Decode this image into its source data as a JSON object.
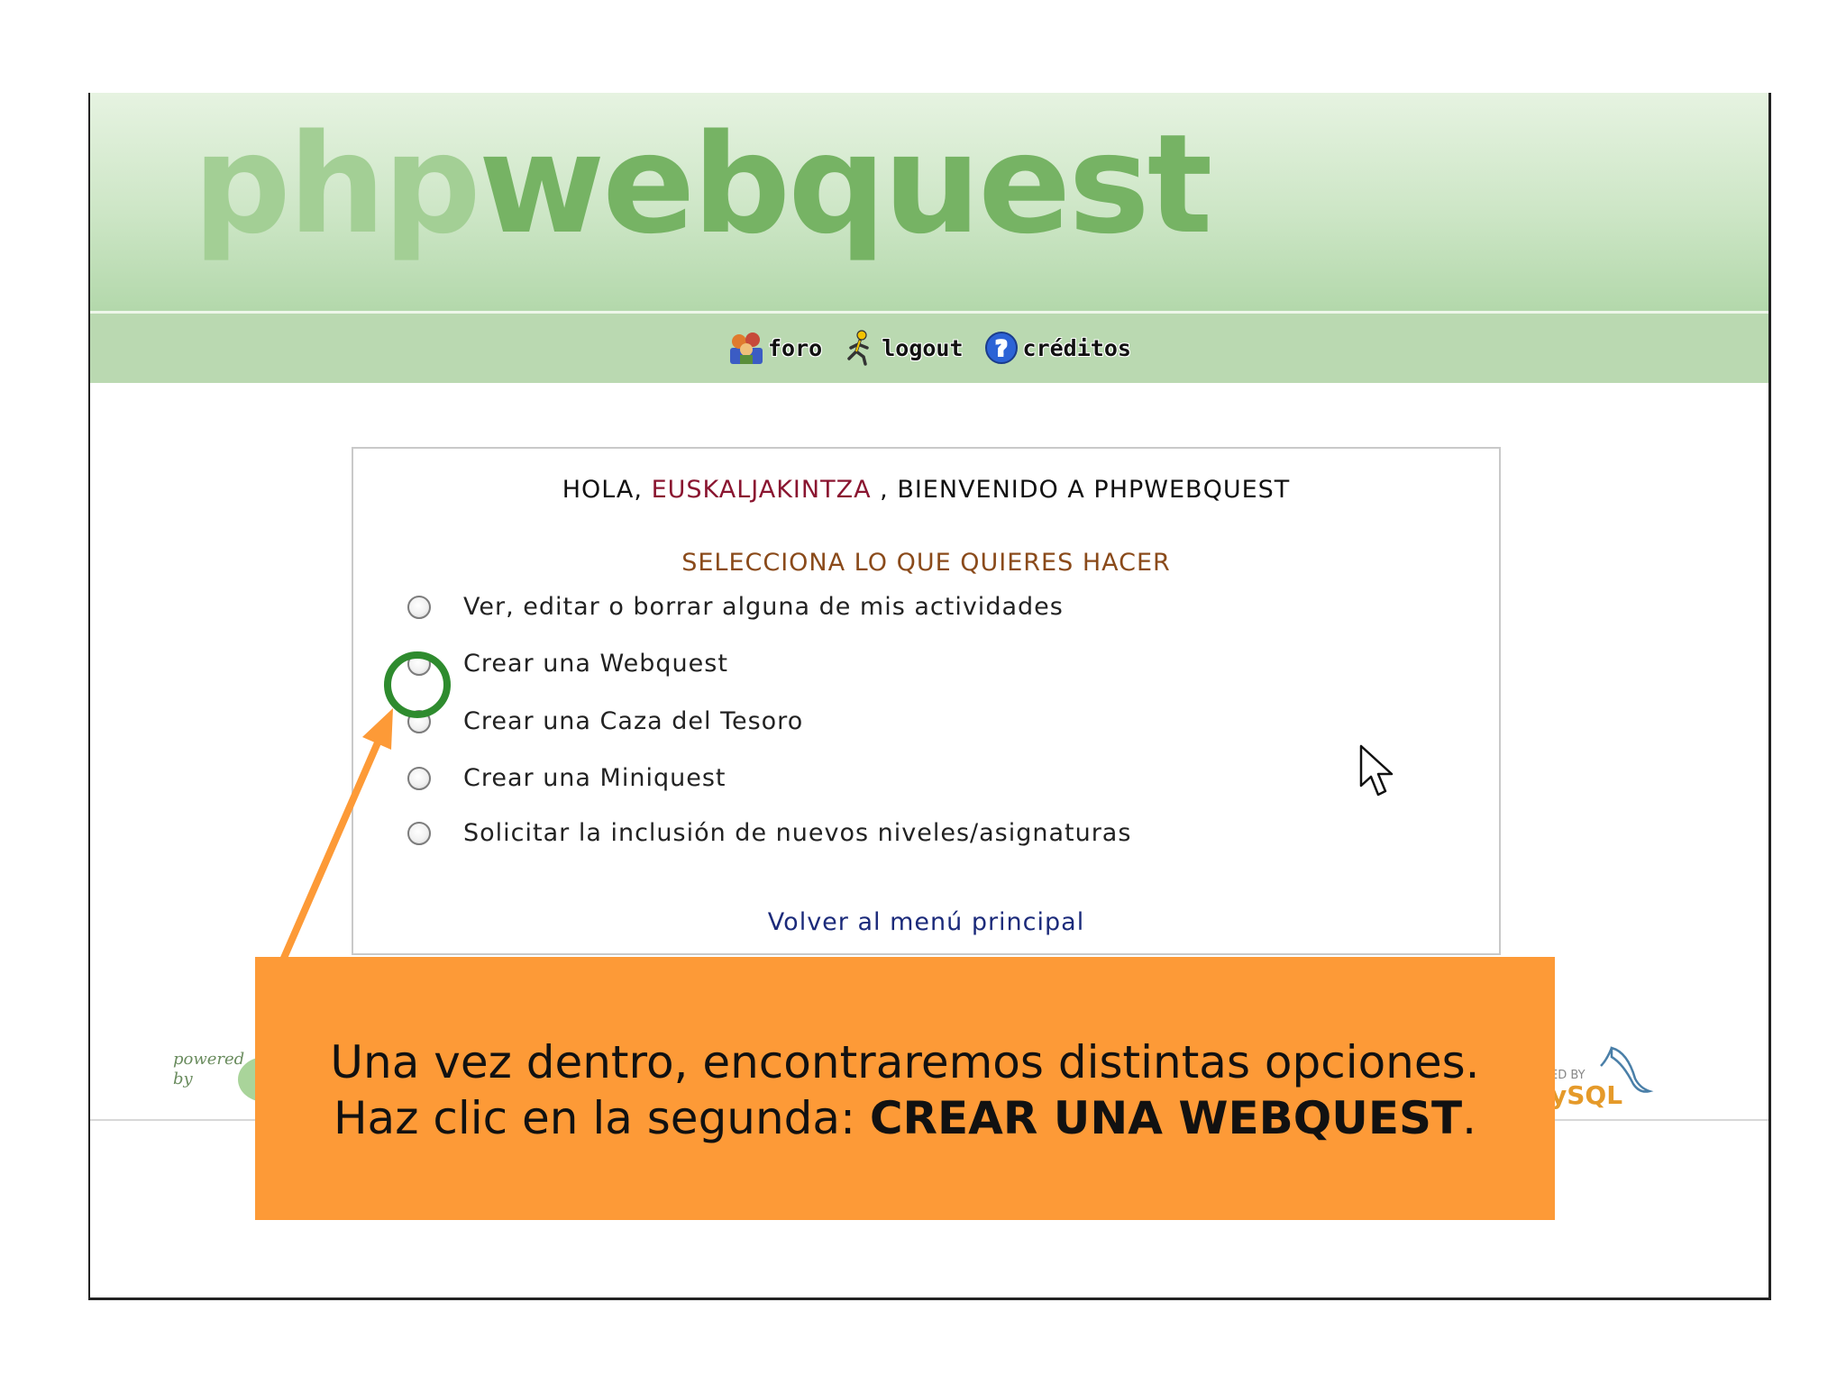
{
  "header": {
    "logo": {
      "part1": "php",
      "part2": "webquest"
    },
    "nav": [
      {
        "label": "foro",
        "icon": "forum-people-icon"
      },
      {
        "label": "logout",
        "icon": "running-man-icon"
      },
      {
        "label": "créditos",
        "icon": "help-icon"
      }
    ]
  },
  "panel": {
    "greeting_prefix": "HOLA,",
    "username": "EUSKALJAKINTZA",
    "greeting_suffix": ", BIENVENIDO A PHPWEBQUEST",
    "select_title": "SELECCIONA LO QUE QUIERES HACER",
    "options": [
      "Ver, editar o borrar alguna de mis actividades",
      "Crear una Webquest",
      "Crear una Caza del Tesoro",
      "Crear una Miniquest",
      "Solicitar la inclusión de nuevos niveles/asignaturas"
    ],
    "back_link": "Volver al menú principal"
  },
  "footer": {
    "powered_left": [
      "powered",
      "by"
    ],
    "powered_right_text": "ED BY",
    "powered_right_logo": "ySQL"
  },
  "callout": {
    "line1": "Una vez dentro, encontraremos distintas opciones.",
    "line2_prefix": "Haz clic en la segunda: ",
    "line2_bold": "CREAR UNA WEBQUEST",
    "line2_suffix": "."
  },
  "colors": {
    "banner": "#cde6c6",
    "navbar": "#bad9b1",
    "username": "#8a1530",
    "select_title": "#8a4a1a",
    "link": "#1b2a7a",
    "callout": "#fd9a37",
    "highlight_circle": "#2e8b2e",
    "arrow": "#fd9a37"
  }
}
